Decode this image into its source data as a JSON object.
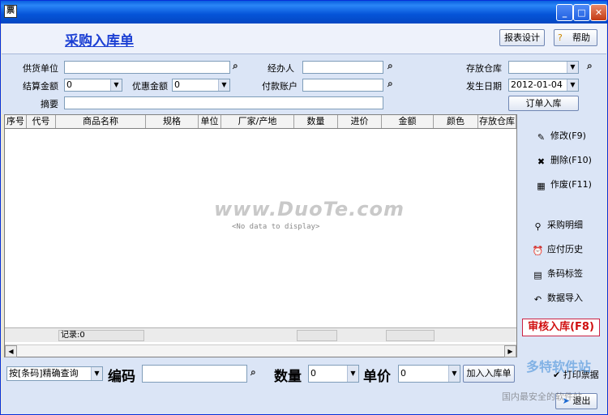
{
  "window": {
    "icon": "app-icon",
    "minimize": "_",
    "maximize": "□",
    "close": "✕"
  },
  "header": {
    "title": "采购入库单",
    "report_design": "报表设计",
    "help": "帮助"
  },
  "form": {
    "supplier_label": "供货单位",
    "supplier_value": "",
    "handler_label": "经办人",
    "handler_value": "",
    "warehouse_label": "存放仓库",
    "warehouse_value": "",
    "settle_label": "结算金额",
    "settle_value": "0",
    "discount_label": "优惠金额",
    "discount_value": "0",
    "account_label": "付款账户",
    "account_value": "",
    "date_label": "发生日期",
    "date_value": "2012-01-04",
    "memo_label": "摘要",
    "memo_value": "",
    "order_in_button": "订单入库"
  },
  "grid": {
    "columns": [
      "序号",
      "代号",
      "商品名称",
      "规格",
      "单位",
      "厂家/产地",
      "数量",
      "进价",
      "金额",
      "颜色",
      "存放仓库"
    ],
    "empty_text": "<No data to display>",
    "watermark": "www.DuoTe.com",
    "record_count": "记录:0"
  },
  "side": {
    "modify": "修改(F9)",
    "delete": "删除(F10)",
    "void": "作废(F11)",
    "purchase_detail": "采购明细",
    "payable_history": "应付历史",
    "barcode_label": "条码标签",
    "data_import": "数据导入",
    "audit": "审核入库(F8)"
  },
  "bottom": {
    "query_mode": "按[条码]精确查询",
    "code_label": "编码",
    "code_value": "",
    "qty_label": "数量",
    "qty_value": "0",
    "price_label": "单价",
    "price_value": "0",
    "add_button": "加入入库单",
    "print_ticket": "打印票据",
    "exit": "退出"
  },
  "brand": {
    "logo_text": "多特软件站",
    "slogan": "国内最安全的软件站"
  },
  "colors": {
    "title": "#1b3fd3",
    "audit": "#d01010",
    "panel": "#dbe5f6"
  }
}
